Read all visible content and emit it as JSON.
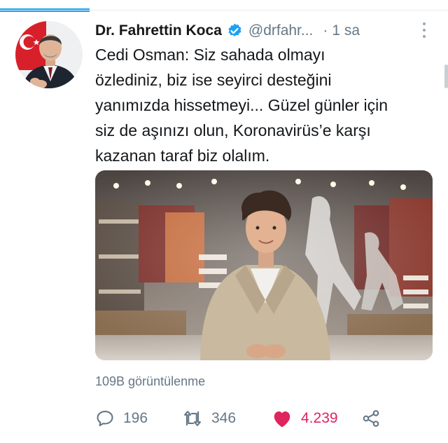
{
  "tweet": {
    "author_name": "Dr. Fahrettin Koca",
    "handle": "@drfahr...",
    "separator": "·",
    "time": "1 sa",
    "text_lines": [
      "Cedi Osman: Siz sahada olmayı",
      "özlediniz, biz ise seyirci desteğini",
      "yanımızda hissetmeyi... Güzel günler için",
      "siz de aşınızı olun, Koronavirüs’e karşı",
      "kazanan taraf biz olalım."
    ],
    "views": "109B görüntülenme"
  },
  "actions": {
    "reply_count": "196",
    "retweet_count": "346",
    "like_count": "4.239"
  },
  "icons": {
    "verified": "verified-badge-icon",
    "menu": "more-vertical-icon",
    "reply": "reply-icon",
    "retweet": "retweet-icon",
    "like": "heart-icon",
    "share": "share-icon"
  },
  "colors": {
    "accent": "#1da1f2",
    "like": "#e0245e",
    "muted": "#657786",
    "text": "#14171a"
  }
}
